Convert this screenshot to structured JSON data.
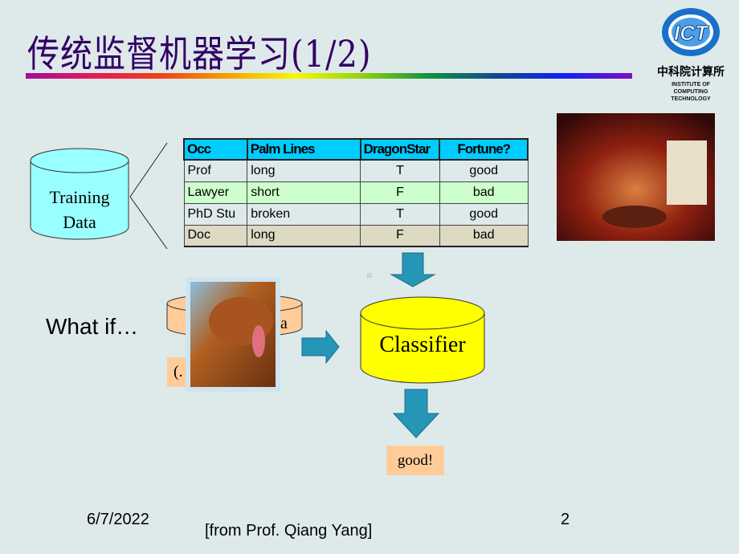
{
  "title": "传统监督机器学习(1/2)",
  "logo": {
    "text": "ICT",
    "chinese": "中科院计算所",
    "institute": [
      "INSTITUTE OF",
      "COMPUTING",
      "TECHNOLOGY"
    ]
  },
  "training_data": {
    "line1": "Training",
    "line2": "Data"
  },
  "table": {
    "headers": [
      "Occ",
      "Palm Lines",
      "DragonStar",
      "Fortune?"
    ],
    "rows": [
      [
        "Prof",
        "long",
        "T",
        "good"
      ],
      [
        "Lawyer",
        "short",
        "F",
        "bad"
      ],
      [
        "PhD Stu",
        "broken",
        "T",
        "good"
      ],
      [
        "Doc",
        "long",
        "F",
        "bad"
      ]
    ],
    "row_colors": [
      "#deeaea",
      "#ccffcc",
      "#deeaea",
      "#ddd9c3"
    ]
  },
  "what_if": "What if…",
  "hidden_cyl_text": "a",
  "hidden_box_text": "(.",
  "classifier": "Classifier",
  "result": "good!",
  "footer": {
    "date": "6/7/2022",
    "source": "[from Prof. Qiang Yang]",
    "page": "2"
  },
  "colors": {
    "title": "#330066",
    "header": "#00ccff",
    "classifier": "#ffff00",
    "training": "#99ffff",
    "arrow": "#2596b8",
    "result_bg": "#ffcc99"
  }
}
